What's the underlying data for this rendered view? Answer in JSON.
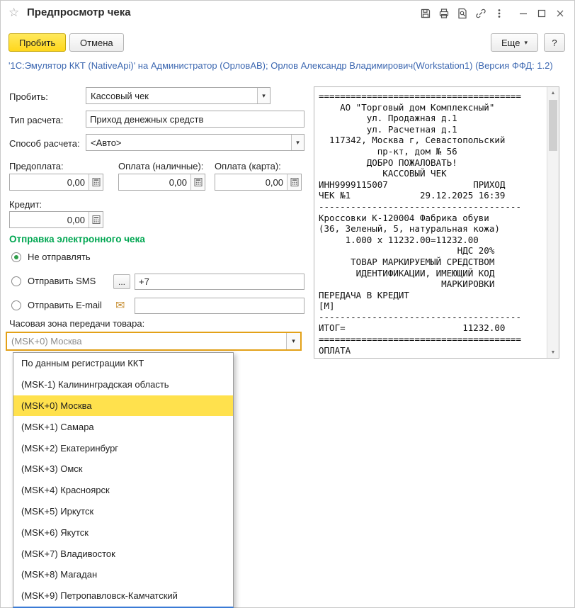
{
  "window": {
    "title": "Предпросмотр чека"
  },
  "toolbar": {
    "commit": "Пробить",
    "cancel": "Отмена",
    "more": "Еще",
    "help": "?"
  },
  "info_line": "'1С:Эмулятор ККТ (NativeApi)' на Администратор (ОрловАВ); Орлов Александр Владимирович(Workstation1) (Версия ФФД: 1.2)",
  "form": {
    "fields": {
      "probit": {
        "label": "Пробить:",
        "value": "Кассовый чек"
      },
      "calc_type": {
        "label": "Тип расчета:",
        "value": "Приход денежных средств"
      },
      "calc_method": {
        "label": "Способ расчета:",
        "value": "<Авто>"
      },
      "prepayment": {
        "label": "Предоплата:",
        "value": "0,00"
      },
      "cash": {
        "label": "Оплата (наличные):",
        "value": "0,00"
      },
      "card": {
        "label": "Оплата (карта):",
        "value": "0,00"
      },
      "credit": {
        "label": "Кредит:",
        "value": "0,00"
      }
    }
  },
  "electronic": {
    "header": "Отправка электронного чека",
    "options": [
      {
        "label": "Не отправлять",
        "selected": true
      },
      {
        "label": "Отправить SMS",
        "selected": false,
        "value": "+7"
      },
      {
        "label": "Отправить E-mail",
        "selected": false,
        "value": ""
      }
    ]
  },
  "timezone": {
    "label": "Часовая зона передачи товара:",
    "value": "(MSK+0) Москва",
    "selected_index": 2,
    "options": [
      "По данным регистрации ККТ",
      "(MSK-1) Калининградская область",
      "(MSK+0) Москва",
      "(MSK+1) Самара",
      "(MSK+2) Екатеринбург",
      "(MSK+3) Омск",
      "(MSK+4) Красноярск",
      "(MSK+5) Иркутск",
      "(MSK+6) Якутск",
      "(MSK+7) Владивосток",
      "(MSK+8) Магадан",
      "(MSK+9) Петропавловск-Камчатский"
    ]
  },
  "receipt": {
    "lines": [
      "======================================",
      "    АО \"Торговый дом Комплексный\"",
      "         ул. Продажная д.1",
      "         ул. Расчетная д.1",
      "  117342, Москва г, Севастопольский",
      "           пр-кт, дом № 56",
      "         ДОБРО ПОЖАЛОВАТЬ!",
      "            КАССОВЫЙ ЧЕК",
      "ИНН9999115007                ПРИХОД",
      "ЧЕК №1             29.12.2025 16:39",
      "--------------------------------------",
      "Кроссовки К-120004 Фабрика обуви",
      "(36, Зеленый, 5, натуральная кожа)",
      "     1.000 x 11232.00=11232.00",
      "                          НДС 20%",
      "      ТОВАР МАРКИРУЕМЫЙ СРЕДСТВОМ",
      "       ИДЕНТИФИКАЦИИ, ИМЕЮЩИЙ КОД",
      "                       МАРКИРОВКИ",
      "ПЕРЕДАЧА В КРЕДИТ",
      "[М]",
      "--------------------------------------",
      "ИТОГ=                      11232.00",
      "======================================",
      "ОПЛАТА"
    ]
  },
  "icons": {
    "star": "☆",
    "dropdown_arrow": "▾",
    "ellipsis": "...",
    "envelope": "✉",
    "scroll_up": "▲",
    "scroll_down": "▼"
  },
  "colors": {
    "accent_yellow": "#ffd71c",
    "link_blue": "#3d68b1",
    "section_green": "#00a651",
    "selection_yellow": "#ffe14d",
    "focus_border": "#e3a118"
  }
}
